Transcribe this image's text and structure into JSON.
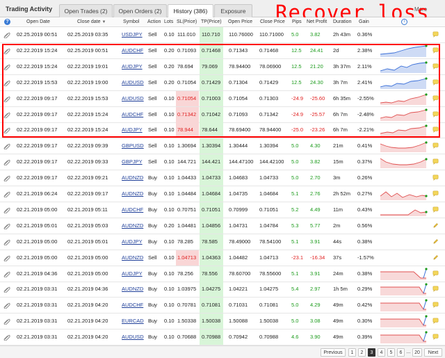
{
  "tabs": {
    "app_title": "Trading Activity",
    "items": [
      {
        "label": "Open Trades (2)"
      },
      {
        "label": "Open Orders (2)"
      },
      {
        "label": "History (386)"
      },
      {
        "label": "Exposure"
      }
    ],
    "more_label": "More"
  },
  "overlay_text": "Recover loss",
  "columns": {
    "open_date": "Open Date",
    "close_date": "Close date",
    "symbol": "Symbol",
    "action": "Action",
    "lots": "Lots",
    "sl": "SL(Price)",
    "tp": "TP(Price)",
    "open_price": "Open Price",
    "close_price": "Close Price",
    "pips": "Pips",
    "net_profit": "Net Profit",
    "duration": "Duration",
    "gain": "Gain"
  },
  "rows": [
    {
      "open": "02.25.2019 00:51",
      "close": "02.25.2019 03:35",
      "symbol": "USDJPY",
      "action": "Sell",
      "lots": "0.10",
      "sl": "111.010",
      "tp": "110.710",
      "open_price": "110.76000",
      "close_price": "110.71000",
      "pips": "5.0",
      "profit": "3.82",
      "duration": "2h 43m",
      "gain": "0.36%",
      "sl_red": false,
      "neg": false,
      "spark": null,
      "comment": true
    },
    {
      "open": "02.22.2019 15:24",
      "close": "02.25.2019 00:51",
      "symbol": "AUDCHF",
      "action": "Sell",
      "lots": "0.20",
      "sl": "0.71093",
      "tp": "0.71468",
      "open_price": "0.71343",
      "close_price": "0.71468",
      "pips": "12.5",
      "profit": "24.41",
      "duration": "2d",
      "gain": "2.38%",
      "sl_red": false,
      "neg": false,
      "spark": "blue1",
      "comment": true
    },
    {
      "open": "02.22.2019 15:24",
      "close": "02.22.2019 19:01",
      "symbol": "AUDJPY",
      "action": "Sell",
      "lots": "0.20",
      "sl": "78.694",
      "tp": "79.069",
      "open_price": "78.94400",
      "close_price": "78.06900",
      "pips": "12.5",
      "profit": "21.20",
      "duration": "3h 37m",
      "gain": "2.11%",
      "sl_red": false,
      "neg": false,
      "spark": "blue2",
      "comment": true
    },
    {
      "open": "02.22.2019 15:53",
      "close": "02.22.2019 19:00",
      "symbol": "AUDUSD",
      "action": "Sell",
      "lots": "0.20",
      "sl": "0.71054",
      "tp": "0.71429",
      "open_price": "0.71304",
      "close_price": "0.71429",
      "pips": "12.5",
      "profit": "24.30",
      "duration": "3h 7m",
      "gain": "2.41%",
      "sl_red": false,
      "neg": false,
      "spark": "blue3",
      "comment": true
    },
    {
      "open": "02.22.2019 09:17",
      "close": "02.22.2019 15:53",
      "symbol": "AUDUSD",
      "action": "Sell",
      "lots": "0.10",
      "sl": "0.71054",
      "tp": "0.71003",
      "open_price": "0.71054",
      "close_price": "0.71303",
      "pips": "-24.9",
      "profit": "-25.60",
      "duration": "6h 35m",
      "gain": "-2.55%",
      "sl_red": true,
      "neg": true,
      "spark": "red1",
      "comment": true
    },
    {
      "open": "02.22.2019 09:17",
      "close": "02.22.2019 15:24",
      "symbol": "AUDCHF",
      "action": "Sell",
      "lots": "0.10",
      "sl": "0.71342",
      "tp": "0.71042",
      "open_price": "0.71093",
      "close_price": "0.71342",
      "pips": "-24.9",
      "profit": "-25.57",
      "duration": "6h 7m",
      "gain": "-2.48%",
      "sl_red": true,
      "neg": true,
      "spark": "red2",
      "comment": true
    },
    {
      "open": "02.22.2019 09:17",
      "close": "02.22.2019 15:24",
      "symbol": "AUDJPY",
      "action": "Sell",
      "lots": "0.10",
      "sl": "78.944",
      "tp": "78.644",
      "open_price": "78.69400",
      "close_price": "78.94400",
      "pips": "-25.0",
      "profit": "-23.26",
      "duration": "6h 7m",
      "gain": "-2.21%",
      "sl_red": true,
      "neg": true,
      "spark": "red3",
      "comment": true
    },
    {
      "open": "02.22.2019 09:17",
      "close": "02.22.2019 09:39",
      "symbol": "GBPUSD",
      "action": "Sell",
      "lots": "0.10",
      "sl": "1.30694",
      "tp": "1.30394",
      "open_price": "1.30444",
      "close_price": "1.30394",
      "pips": "5.0",
      "profit": "4.30",
      "duration": "21m",
      "gain": "0.41%",
      "sl_red": false,
      "neg": false,
      "spark": "red4",
      "comment": true
    },
    {
      "open": "02.22.2019 09:17",
      "close": "02.22.2019 09:33",
      "symbol": "GBPJPY",
      "action": "Sell",
      "lots": "0.10",
      "sl": "144.721",
      "tp": "144.421",
      "open_price": "144.47100",
      "close_price": "144.42100",
      "pips": "5.0",
      "profit": "3.82",
      "duration": "15m",
      "gain": "0.37%",
      "sl_red": false,
      "neg": false,
      "spark": "red5",
      "comment": true
    },
    {
      "open": "02.22.2019 09:17",
      "close": "02.22.2019 09:21",
      "symbol": "AUDNZD",
      "action": "Buy",
      "lots": "0.10",
      "sl": "1.04433",
      "tp": "1.04733",
      "open_price": "1.04683",
      "close_price": "1.04733",
      "pips": "5.0",
      "profit": "2.70",
      "duration": "3m",
      "gain": "0.26%",
      "sl_red": false,
      "neg": false,
      "spark": null,
      "comment": true
    },
    {
      "open": "02.21.2019 06:24",
      "close": "02.22.2019 09:17",
      "symbol": "AUDNZD",
      "action": "Buy",
      "lots": "0.10",
      "sl": "1.04484",
      "tp": "1.04684",
      "open_price": "1.04735",
      "close_price": "1.04684",
      "pips": "5.1",
      "profit": "2.76",
      "duration": "2h 52m",
      "gain": "0.27%",
      "sl_red": false,
      "neg": false,
      "spark": "red6",
      "comment": true
    },
    {
      "open": "02.21.2019 05:00",
      "close": "02.21.2019 05:11",
      "symbol": "AUDCHF",
      "action": "Buy",
      "lots": "0.10",
      "sl": "0.70751",
      "tp": "0.71051",
      "open_price": "0.70999",
      "close_price": "0.71051",
      "pips": "5.2",
      "profit": "4.49",
      "duration": "11m",
      "gain": "0.43%",
      "sl_red": false,
      "neg": false,
      "spark": "red7",
      "comment": true
    },
    {
      "open": "02.21.2019 05:01",
      "close": "02.21.2019 05:03",
      "symbol": "AUDNZD",
      "action": "Buy",
      "lots": "0.20",
      "sl": "1.04481",
      "tp": "1.04856",
      "open_price": "1.04731",
      "close_price": "1.04784",
      "pips": "5.3",
      "profit": "5.77",
      "duration": "2m",
      "gain": "0.56%",
      "sl_red": false,
      "neg": false,
      "spark": null,
      "comment": false
    },
    {
      "open": "02.21.2019 05:00",
      "close": "02.21.2019 05:01",
      "symbol": "AUDJPY",
      "action": "Buy",
      "lots": "0.10",
      "sl": "78.285",
      "tp": "78.585",
      "open_price": "78.49000",
      "close_price": "78.54100",
      "pips": "5.1",
      "profit": "3.91",
      "duration": "44s",
      "gain": "0.38%",
      "sl_red": false,
      "neg": false,
      "spark": null,
      "comment": false
    },
    {
      "open": "02.21.2019 05:00",
      "close": "02.21.2019 05:00",
      "symbol": "AUDNZD",
      "action": "Sell",
      "lots": "0.10",
      "sl": "1.04713",
      "tp": "1.04363",
      "open_price": "1.04482",
      "close_price": "1.04713",
      "pips": "-23.1",
      "profit": "-16.34",
      "duration": "37s",
      "gain": "-1.57%",
      "sl_red": true,
      "neg": true,
      "spark": null,
      "comment": false
    },
    {
      "open": "02.21.2019 04:36",
      "close": "02.21.2019 05:00",
      "symbol": "AUDJPY",
      "action": "Buy",
      "lots": "0.10",
      "sl": "78.256",
      "tp": "78.556",
      "open_price": "78.60700",
      "close_price": "78.55600",
      "pips": "5.1",
      "profit": "3.91",
      "duration": "24m",
      "gain": "0.38%",
      "sl_red": false,
      "neg": false,
      "spark": "red8",
      "comment": true
    },
    {
      "open": "02.21.2019 03:31",
      "close": "02.21.2019 04:36",
      "symbol": "AUDNZD",
      "action": "Buy",
      "lots": "0.10",
      "sl": "1.03975",
      "tp": "1.04275",
      "open_price": "1.04221",
      "close_price": "1.04275",
      "pips": "5.4",
      "profit": "2.97",
      "duration": "1h 5m",
      "gain": "0.29%",
      "sl_red": false,
      "neg": false,
      "spark": "red9",
      "comment": true
    },
    {
      "open": "02.21.2019 03:31",
      "close": "02.21.2019 04:20",
      "symbol": "AUDCHF",
      "action": "Buy",
      "lots": "0.10",
      "sl": "0.70781",
      "tp": "0.71081",
      "open_price": "0.71031",
      "close_price": "0.71081",
      "pips": "5.0",
      "profit": "4.29",
      "duration": "49m",
      "gain": "0.42%",
      "sl_red": false,
      "neg": false,
      "spark": "red10",
      "comment": true
    },
    {
      "open": "02.21.2019 03:31",
      "close": "02.21.2019 04:20",
      "symbol": "EURCAD",
      "action": "Buy",
      "lots": "0.10",
      "sl": "1.50338",
      "tp": "1.50038",
      "open_price": "1.50088",
      "close_price": "1.50038",
      "pips": "5.0",
      "profit": "3.08",
      "duration": "49m",
      "gain": "0.30%",
      "sl_red": false,
      "neg": false,
      "spark": "red11",
      "comment": true
    },
    {
      "open": "02.21.2019 03:31",
      "close": "02.21.2019 04:20",
      "symbol": "AUDUSD",
      "action": "Buy",
      "lots": "0.10",
      "sl": "0.70688",
      "tp": "0.70988",
      "open_price": "0.70942",
      "close_price": "0.70988",
      "pips": "4.6",
      "profit": "3.90",
      "duration": "49m",
      "gain": "0.39%",
      "sl_red": false,
      "neg": false,
      "spark": "red12",
      "comment": true
    }
  ],
  "pagination": {
    "previous": "Previous",
    "pages": [
      "1",
      "2",
      "3",
      "4",
      "5",
      "6",
      "...",
      "20"
    ],
    "current": "3",
    "next": "Next"
  },
  "colors": {
    "positive": "#1a9a1a",
    "negative": "#e02020",
    "highlight": "#ff0000",
    "tp_bg": "#d8f5d8",
    "sl_bg": "#f9d6d6",
    "spark_blue": "#3a6fd8",
    "spark_red": "#e05050"
  }
}
